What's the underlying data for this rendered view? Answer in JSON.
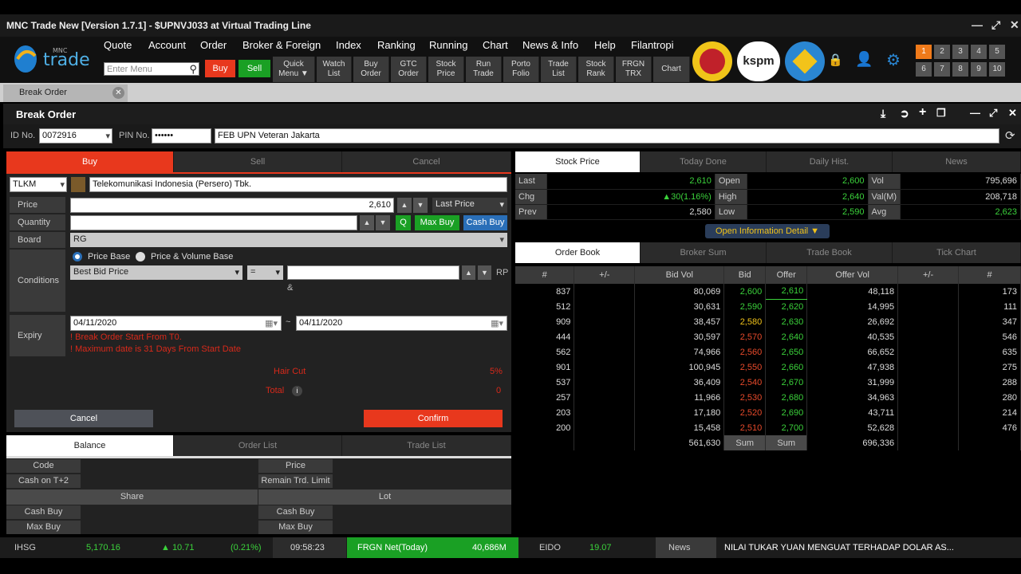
{
  "window": {
    "title": "MNC Trade New [Version 1.7.1] - $UPNVJ033 at Virtual Trading Line"
  },
  "menu": [
    "Quote",
    "Account",
    "Order",
    "Broker & Foreign",
    "Index",
    "Ranking",
    "Running",
    "Chart",
    "News & Info",
    "Help",
    "Filantropi"
  ],
  "search_placeholder": "Enter Menu",
  "buy_label": "Buy",
  "sell_label": "Sell",
  "toolbar": [
    [
      "Quick",
      "Menu ▼"
    ],
    [
      "Watch",
      "List"
    ],
    [
      "Buy",
      "Order"
    ],
    [
      "GTC",
      "Order"
    ],
    [
      "Stock",
      "Price"
    ],
    [
      "Run",
      "Trade"
    ],
    [
      "Porto",
      "Folio"
    ],
    [
      "Trade",
      "List"
    ],
    [
      "Stock",
      "Rank"
    ],
    [
      "FRGN",
      "TRX"
    ],
    [
      "Chart",
      ""
    ]
  ],
  "logos": [
    "univ",
    "kspm",
    "tut wuri"
  ],
  "num_buttons": [
    "1",
    "2",
    "3",
    "4",
    "5",
    "6",
    "7",
    "8",
    "9",
    "10"
  ],
  "tab": "Break Order",
  "panel_title": "Break Order",
  "id_label": "ID No.",
  "id_value": "0072916",
  "pin_label": "PIN No.",
  "pin_value": "••••••",
  "account_name": "FEB UPN Veteran Jakarta",
  "order_tabs": [
    "Buy",
    "Sell",
    "Cancel"
  ],
  "stock_code": "TLKM",
  "stock_name": "Telekomunikasi Indonesia (Persero) Tbk.",
  "price_label": "Price",
  "price_value": "2,610",
  "price_type": "Last Price",
  "quantity_label": "Quantity",
  "q_btn": "Q",
  "max_buy": "Max Buy",
  "cash_buy": "Cash Buy",
  "board_label": "Board",
  "board_value": "RG",
  "conditions_label": "Conditions",
  "radio1": "Price Base",
  "radio2": "Price & Volume Base",
  "cond_select": "Best Bid Price",
  "cond_op": "=",
  "rp": "RP",
  "amp": "&",
  "expiry_label": "Expiry",
  "date_from": "04/11/2020",
  "date_to": "04/11/2020",
  "date_sep": "~",
  "warn1": "! Break Order Start From T0.",
  "warn2": "! Maximum date is 31 Days From Start Date",
  "haircut_label": "Hair Cut",
  "haircut_value": "5%",
  "total_label": "Total",
  "total_value": "0",
  "cancel_btn": "Cancel",
  "confirm_btn": "Confirm",
  "bal_tabs": [
    "Balance",
    "Order List",
    "Trade List"
  ],
  "balance": {
    "code": "Code",
    "cash_t2": "Cash on T+2",
    "price": "Price",
    "remain": "Remain Trd. Limit",
    "share": "Share",
    "lot": "Lot",
    "cash_buy1": "Cash Buy",
    "max_buy1": "Max Buy",
    "cash_buy2": "Cash Buy",
    "max_buy2": "Max Buy"
  },
  "sp_tabs": [
    "Stock Price",
    "Today Done",
    "Daily Hist.",
    "News"
  ],
  "stock_price": [
    [
      "Last",
      "2,610",
      "Open",
      "2,600",
      "Vol",
      "795,696"
    ],
    [
      "Chg",
      "▲30(1.16%)",
      "High",
      "2,640",
      "Val(M)",
      "208,718"
    ],
    [
      "Prev",
      "2,580",
      "Low",
      "2,590",
      "Avg",
      "2,623"
    ]
  ],
  "open_info": "Open Information Detail ▼",
  "ob_tabs": [
    "Order Book",
    "Broker Sum",
    "Trade Book",
    "Tick Chart"
  ],
  "ob_headers": [
    "#",
    "+/-",
    "Bid Vol",
    "Bid",
    "Offer",
    "Offer Vol",
    "+/-",
    "#"
  ],
  "order_book": [
    [
      "837",
      "",
      "80,069",
      "2,600",
      "2,610",
      "48,118",
      "",
      "173"
    ],
    [
      "512",
      "",
      "30,631",
      "2,590",
      "2,620",
      "14,995",
      "",
      "111"
    ],
    [
      "909",
      "",
      "38,457",
      "2,580",
      "2,630",
      "26,692",
      "",
      "347"
    ],
    [
      "444",
      "",
      "30,597",
      "2,570",
      "2,640",
      "40,535",
      "",
      "546"
    ],
    [
      "562",
      "",
      "74,966",
      "2,560",
      "2,650",
      "66,652",
      "",
      "635"
    ],
    [
      "901",
      "",
      "100,945",
      "2,550",
      "2,660",
      "47,938",
      "",
      "275"
    ],
    [
      "537",
      "",
      "36,409",
      "2,540",
      "2,670",
      "31,999",
      "",
      "288"
    ],
    [
      "257",
      "",
      "11,966",
      "2,530",
      "2,680",
      "34,963",
      "",
      "280"
    ],
    [
      "203",
      "",
      "17,180",
      "2,520",
      "2,690",
      "43,711",
      "",
      "214"
    ],
    [
      "200",
      "",
      "15,458",
      "2,510",
      "2,700",
      "52,628",
      "",
      "476"
    ]
  ],
  "ob_total": {
    "bid_vol": "561,630",
    "bid": "Sum",
    "offer": "Sum",
    "offer_vol": "696,336"
  },
  "status": {
    "ihsg": "IHSG",
    "ihsg_val": "5,170.16",
    "ihsg_chg": "▲ 10.71",
    "ihsg_pct": "(0.21%)",
    "time": "09:58:23",
    "frgn": "FRGN Net(Today)",
    "frgn_val": "40,686M",
    "eido": "EIDO",
    "eido_val": "19.07",
    "news": "News",
    "ticker": "NILAI TUKAR YUAN MENGUAT TERHADAP DOLAR AS..."
  }
}
